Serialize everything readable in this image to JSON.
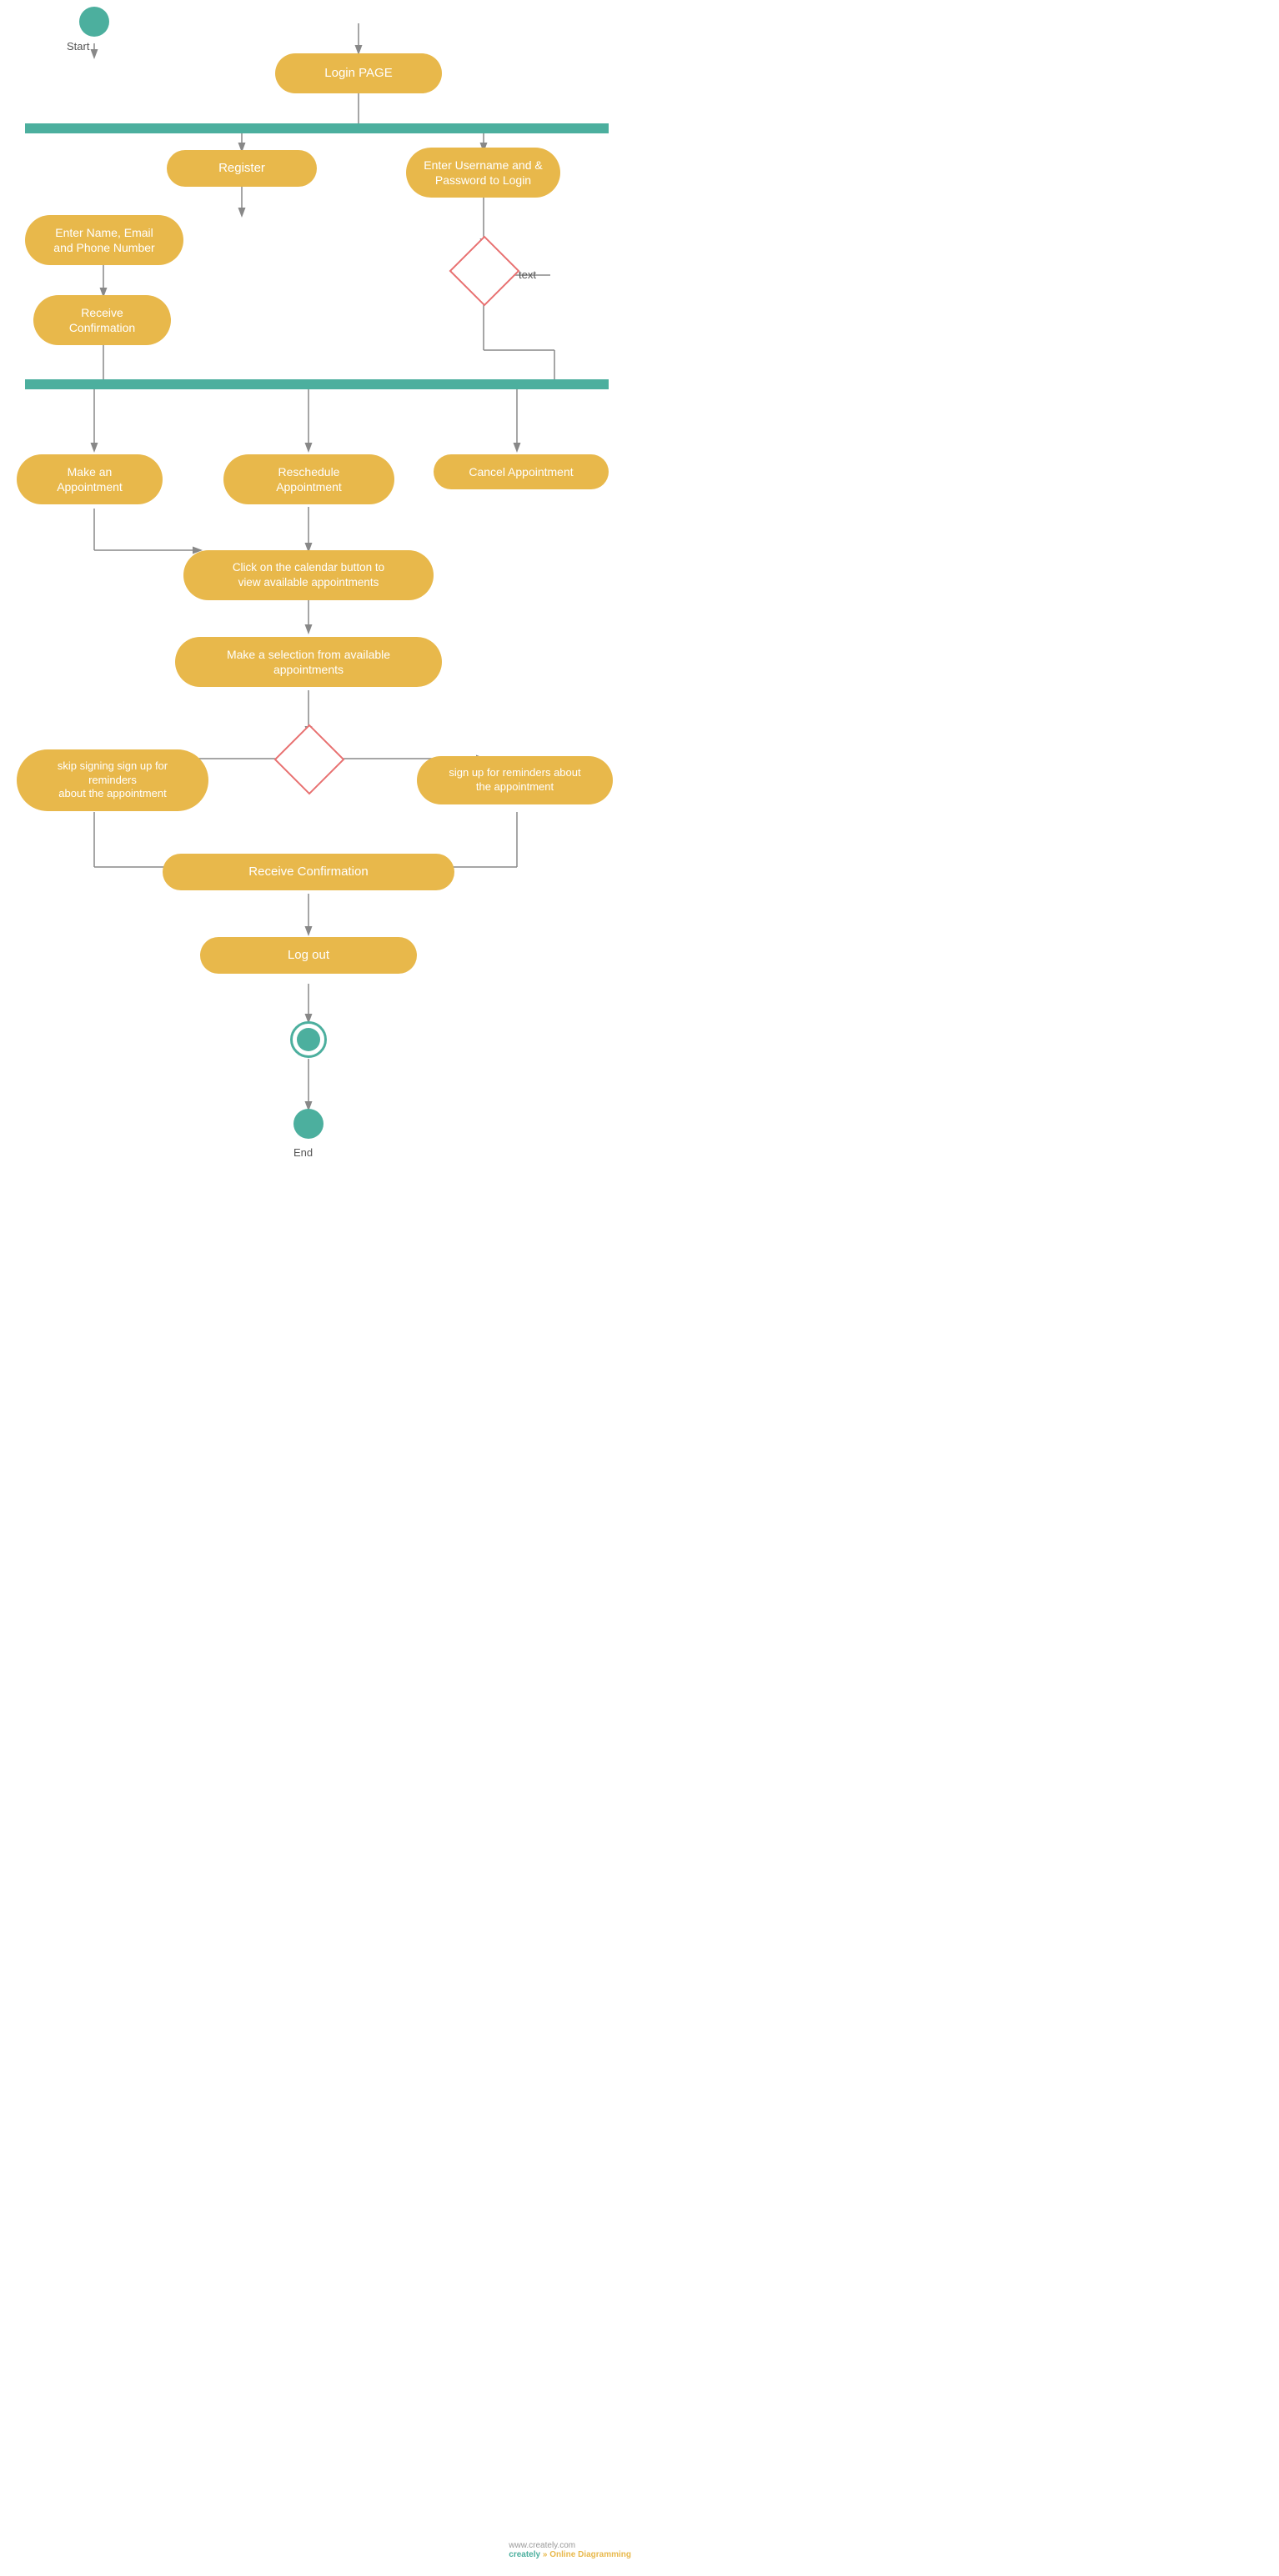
{
  "nodes": {
    "start_label": "Start",
    "end_label": "End",
    "login_page": "Login PAGE",
    "register": "Register",
    "enter_credentials": "Enter Username and &\nPassword to Login",
    "enter_name": "Enter Name, Email\nand Phone Number",
    "receive_confirmation_1": "Receive\nConfirmation",
    "make_appointment": "Make an\nAppointment",
    "reschedule": "Reschedule\nAppointment",
    "cancel": "Cancel Appointment",
    "click_calendar": "Click on the calendar button to\nview available appointments",
    "make_selection": "Make a selection from available\nappointments",
    "skip_reminders": "skip signing sign up for reminders\nabout the appointment",
    "sign_up_reminders": "sign up for reminders about\nthe appointment",
    "receive_confirmation_2": "Receive Confirmation",
    "logout": "Log out",
    "text_label": "text"
  },
  "watermark": {
    "site": "www.creately.com",
    "label1": "creately",
    "label2": "» Online Diagramming"
  }
}
